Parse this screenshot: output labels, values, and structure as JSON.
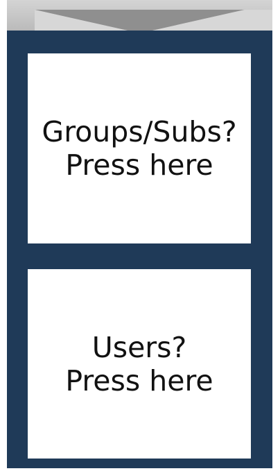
{
  "tiles": [
    {
      "line1": "Groups/Subs?",
      "line2": "Press here"
    },
    {
      "line1": "Users?",
      "line2": "Press here"
    }
  ],
  "colors": {
    "panel_bg": "#1f3a58",
    "tile_bg": "#ffffff",
    "arrow_light": "#c9c9c9",
    "arrow_dark": "#8f8f8f"
  }
}
